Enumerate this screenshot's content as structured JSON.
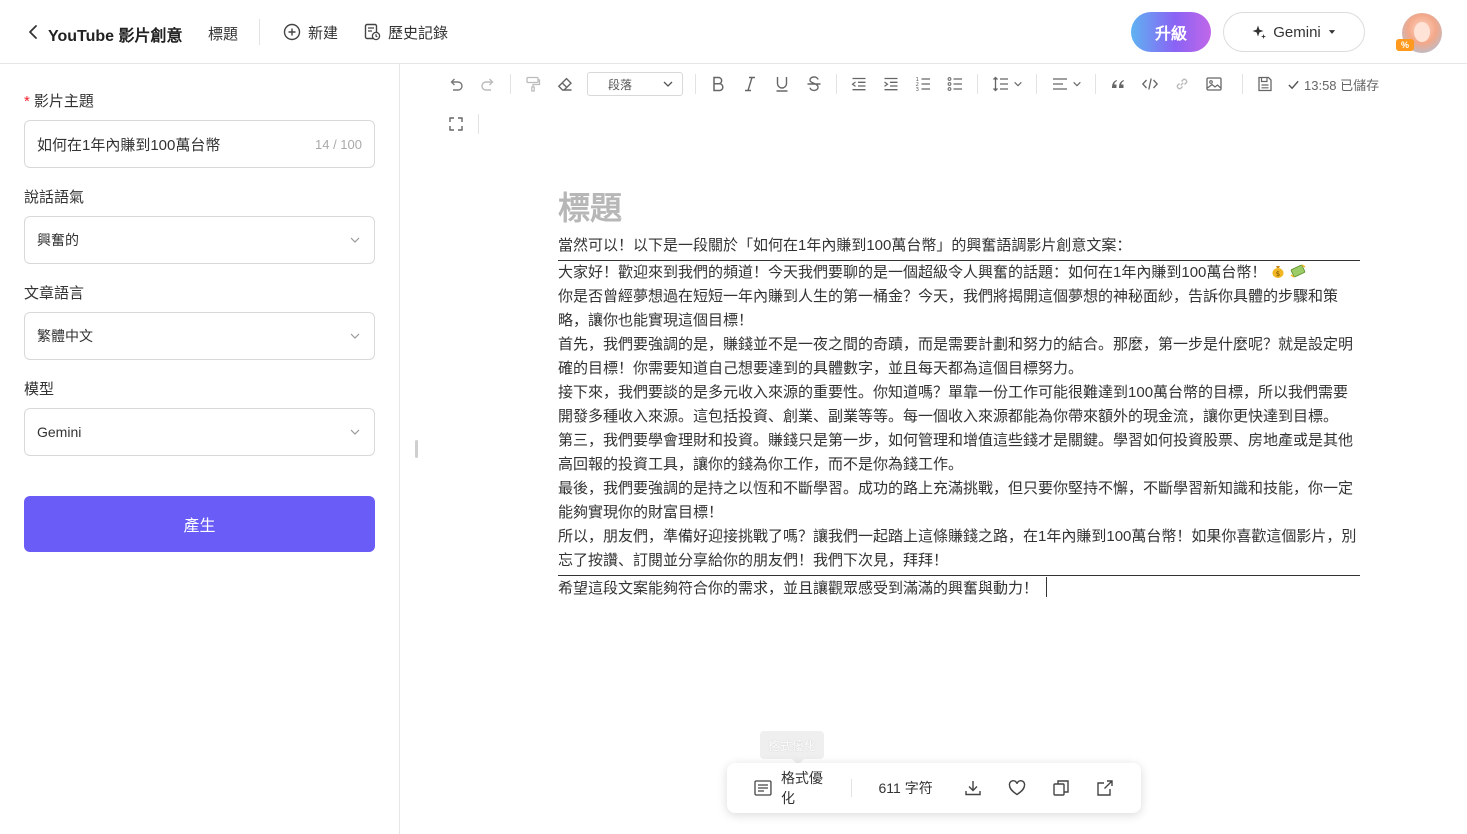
{
  "header": {
    "app_title": "YouTube 影片創意",
    "title_link": "標題",
    "new_label": "新建",
    "history_label": "歷史記錄",
    "upgrade_label": "升級",
    "model_label": "Gemini",
    "avatar_badge": "%"
  },
  "sidebar": {
    "topic": {
      "label": "影片主題",
      "value": "如何在1年內賺到100萬台幣",
      "count": "14 / 100"
    },
    "tone": {
      "label": "說話語氣",
      "value": "興奮的"
    },
    "language": {
      "label": "文章語言",
      "value": "繁體中文"
    },
    "model": {
      "label": "模型",
      "value": "Gemini"
    },
    "generate_label": "產生"
  },
  "toolbar": {
    "paragraph_select": "段落",
    "saved_text": "13:58 已儲存"
  },
  "document": {
    "title_placeholder": "標題",
    "intro": "當然可以！以下是一段關於「如何在1年內賺到100萬台幣」的興奮語調影片創意文案：",
    "paragraphs": [
      "大家好！歡迎來到我們的頻道！今天我們要聊的是一個超級令人興奮的話題：如何在1年內賺到100萬台幣！",
      "你是否曾經夢想過在短短一年內賺到人生的第一桶金？今天，我們將揭開這個夢想的神秘面紗，告訴你具體的步驟和策略，讓你也能實現這個目標！",
      "首先，我們要強調的是，賺錢並不是一夜之間的奇蹟，而是需要計劃和努力的結合。那麼，第一步是什麼呢？就是設定明確的目標！你需要知道自己想要達到的具體數字，並且每天都為這個目標努力。",
      "接下來，我們要談的是多元收入來源的重要性。你知道嗎？單靠一份工作可能很難達到100萬台幣的目標，所以我們需要開發多種收入來源。這包括投資、創業、副業等等。每一個收入來源都能為你帶來額外的現金流，讓你更快達到目標。",
      "第三，我們要學會理財和投資。賺錢只是第一步，如何管理和增值這些錢才是關鍵。學習如何投資股票、房地產或是其他高回報的投資工具，讓你的錢為你工作，而不是你為錢工作。",
      "最後，我們要強調的是持之以恆和不斷學習。成功的路上充滿挑戰，但只要你堅持不懈，不斷學習新知識和技能，你一定能夠實現你的財富目標！",
      "所以，朋友們，準備好迎接挑戰了嗎？讓我們一起踏上這條賺錢之路，在1年內賺到100萬台幣！如果你喜歡這個影片，別忘了按讚、訂閱並分享給你的朋友們！我們下次見，拜拜！"
    ],
    "outro": "希望這段文案能夠符合你的需求，並且讓觀眾感受到滿滿的興奮與動力！"
  },
  "floatbar": {
    "tooltip": "格式優化",
    "format_label": "格式優化",
    "char_count": "611 字符"
  },
  "colors": {
    "primary": "#6a5cf6",
    "required": "#f5222d",
    "title_placeholder": "#b7b7b7"
  }
}
